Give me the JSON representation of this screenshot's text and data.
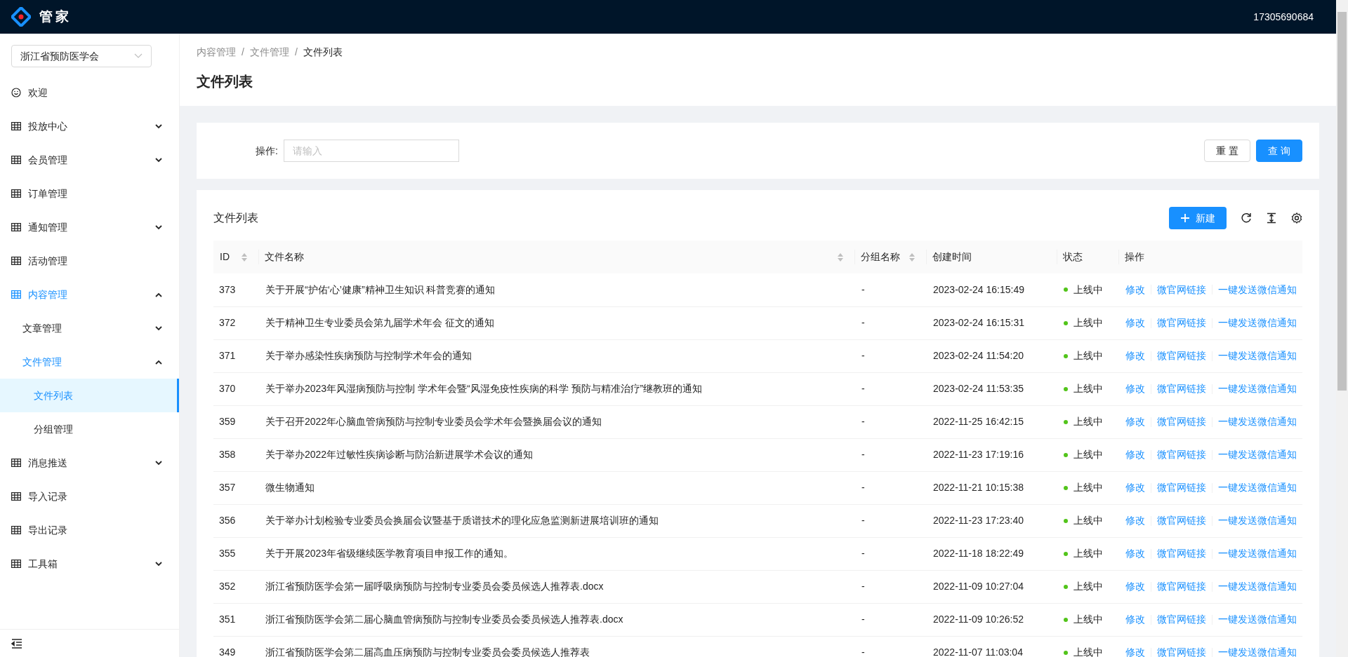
{
  "header": {
    "logo_text": "管家",
    "user": "17305690684"
  },
  "sidebar": {
    "org_select": "浙江省预防医学会",
    "items": [
      {
        "label": "欢迎",
        "selected": false
      },
      {
        "label": "投放中心",
        "expanded": false,
        "selected": false
      },
      {
        "label": "会员管理",
        "expanded": false,
        "selected": false
      },
      {
        "label": "订单管理",
        "selected": false
      },
      {
        "label": "通知管理",
        "expanded": false,
        "selected": false
      },
      {
        "label": "活动管理",
        "selected": false
      },
      {
        "label": "内容管理",
        "expanded": true,
        "selected": true,
        "children": [
          {
            "label": "文章管理",
            "expanded": false,
            "selected": false
          },
          {
            "label": "文件管理",
            "expanded": true,
            "selected": true,
            "children": [
              {
                "label": "文件列表",
                "selected": true
              },
              {
                "label": "分组管理",
                "selected": false
              }
            ]
          }
        ]
      },
      {
        "label": "消息推送",
        "expanded": false,
        "selected": false
      },
      {
        "label": "导入记录",
        "selected": false
      },
      {
        "label": "导出记录",
        "selected": false
      },
      {
        "label": "工具箱",
        "expanded": false,
        "selected": false
      }
    ]
  },
  "breadcrumb": [
    {
      "text": "内容管理",
      "kind": "link"
    },
    {
      "text": "/",
      "kind": "separator"
    },
    {
      "text": "文件管理",
      "kind": "link"
    },
    {
      "text": "/",
      "kind": "separator"
    },
    {
      "text": "文件列表",
      "kind": "current"
    }
  ],
  "page_title": "文件列表",
  "filter": {
    "label": "操作:",
    "placeholder": "请输入",
    "buttons": [
      {
        "label": "重 置",
        "kind": "default"
      },
      {
        "label": "查 询",
        "kind": "primary"
      }
    ]
  },
  "table": {
    "title": "文件列表",
    "new_button": "新建",
    "columns": [
      {
        "label": "ID",
        "sortable": true
      },
      {
        "label": "文件名称",
        "sortable": true
      },
      {
        "label": "分组名称",
        "sortable": true
      },
      {
        "label": "创建时间",
        "sortable": false
      },
      {
        "label": "状态",
        "sortable": false
      },
      {
        "label": "操作",
        "sortable": false
      }
    ],
    "rows": [
      {
        "id": "373",
        "name": "关于开展“护佑‘心’健康”精神卫生知识 科普竞赛的通知",
        "group": "-",
        "created": "2023-02-24 16:15:49",
        "status": "上线中",
        "color": "#52c41a",
        "actions": [
          "修改",
          "微官网链接",
          "一键发送微信通知"
        ]
      },
      {
        "id": "372",
        "name": "关于精神卫生专业委员会第九届学术年会 征文的通知",
        "group": "-",
        "created": "2023-02-24 16:15:31",
        "status": "上线中",
        "color": "#52c41a",
        "actions": [
          "修改",
          "微官网链接",
          "一键发送微信通知"
        ]
      },
      {
        "id": "371",
        "name": "关于举办感染性疾病预防与控制学术年会的通知",
        "group": "-",
        "created": "2023-02-24 11:54:20",
        "status": "上线中",
        "color": "#52c41a",
        "actions": [
          "修改",
          "微官网链接",
          "一键发送微信通知"
        ]
      },
      {
        "id": "370",
        "name": "关于举办2023年风湿病预防与控制 学术年会暨“风湿免疫性疾病的科学 预防与精准治疗”继教班的通知",
        "group": "-",
        "created": "2023-02-24 11:53:35",
        "status": "上线中",
        "color": "#52c41a",
        "actions": [
          "修改",
          "微官网链接",
          "一键发送微信通知"
        ]
      },
      {
        "id": "359",
        "name": "关于召开2022年心脑血管病预防与控制专业委员会学术年会暨换届会议的通知",
        "group": "-",
        "created": "2022-11-25 16:42:15",
        "status": "上线中",
        "color": "#52c41a",
        "actions": [
          "修改",
          "微官网链接",
          "一键发送微信通知"
        ]
      },
      {
        "id": "358",
        "name": "关于举办2022年过敏性疾病诊断与防治新进展学术会议的通知",
        "group": "-",
        "created": "2022-11-23 17:19:16",
        "status": "上线中",
        "color": "#52c41a",
        "actions": [
          "修改",
          "微官网链接",
          "一键发送微信通知"
        ]
      },
      {
        "id": "357",
        "name": "微生物通知",
        "group": "-",
        "created": "2022-11-21 10:15:38",
        "status": "上线中",
        "color": "#52c41a",
        "actions": [
          "修改",
          "微官网链接",
          "一键发送微信通知"
        ]
      },
      {
        "id": "356",
        "name": "关于举办计划检验专业委员会换届会议暨基于质谱技术的理化应急监测新进展培训班的通知",
        "group": "-",
        "created": "2022-11-23 17:23:40",
        "status": "上线中",
        "color": "#52c41a",
        "actions": [
          "修改",
          "微官网链接",
          "一键发送微信通知"
        ]
      },
      {
        "id": "355",
        "name": "关于开展2023年省级继续医学教育项目申报工作的通知。",
        "group": "-",
        "created": "2022-11-18 18:22:49",
        "status": "上线中",
        "color": "#52c41a",
        "actions": [
          "修改",
          "微官网链接",
          "一键发送微信通知"
        ]
      },
      {
        "id": "352",
        "name": "浙江省预防医学会第一届呼吸病预防与控制专业委员会委员候选人推荐表.docx",
        "group": "-",
        "created": "2022-11-09 10:27:04",
        "status": "上线中",
        "color": "#52c41a",
        "actions": [
          "修改",
          "微官网链接",
          "一键发送微信通知"
        ]
      },
      {
        "id": "351",
        "name": "浙江省预防医学会第二届心脑血管病预防与控制专业委员会委员候选人推荐表.docx",
        "group": "-",
        "created": "2022-11-09 10:26:52",
        "status": "上线中",
        "color": "#52c41a",
        "actions": [
          "修改",
          "微官网链接",
          "一键发送微信通知"
        ]
      },
      {
        "id": "349",
        "name": "浙江省预防医学会第二届高血压病预防与控制专业委员会委员候选人推荐表",
        "group": "-",
        "created": "2022-11-07 11:03:04",
        "status": "上线中",
        "color": "#52c41a",
        "actions": [
          "修改",
          "微官网链接",
          "一键发送微信通知"
        ]
      }
    ]
  }
}
